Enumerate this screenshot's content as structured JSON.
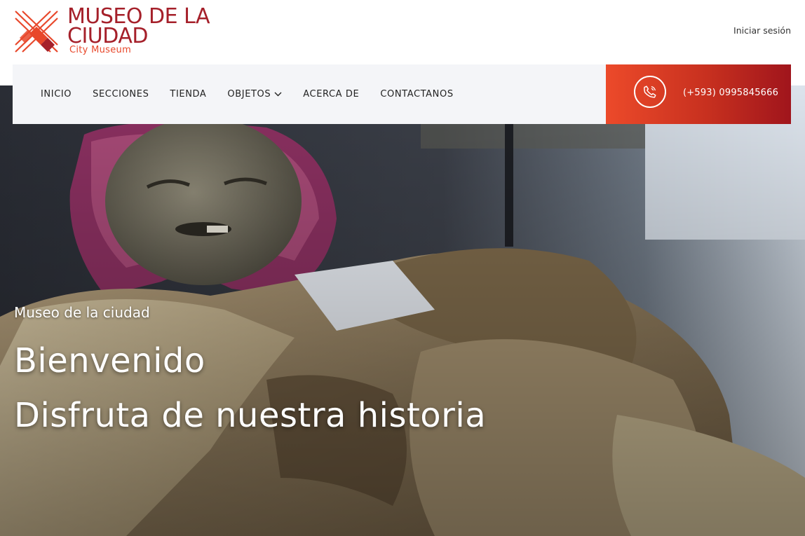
{
  "brand": {
    "title": "MUSEO DE LA\nCIUDAD",
    "subtitle": "City Museum",
    "logo_icon": "crossed-x-logo-icon",
    "colors": {
      "primary": "#a5202a",
      "accent": "#e8472a"
    }
  },
  "header": {
    "login_label": "Iniciar sesión"
  },
  "nav": {
    "items": [
      {
        "label": "INICIO"
      },
      {
        "label": "SECCIONES"
      },
      {
        "label": "TIENDA"
      },
      {
        "label": "OBJETOS",
        "has_dropdown": true
      },
      {
        "label": "ACERCA DE"
      },
      {
        "label": "CONTACTANOS"
      }
    ]
  },
  "contact": {
    "phone_icon": "phone-icon",
    "phone": "(+593) 0995845666",
    "colors": {
      "gradient_start": "#ec4a2a",
      "gradient_end": "#a0151c"
    }
  },
  "hero": {
    "kicker": "Museo de la ciudad",
    "title_line1": "Bienvenido",
    "title_line2": "Disfruta de nuestra historia"
  }
}
